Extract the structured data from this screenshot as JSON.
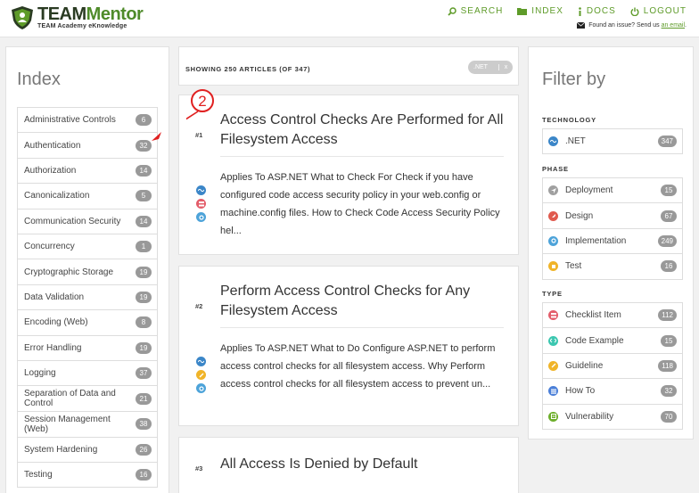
{
  "header": {
    "logo_word1": "TEAM",
    "logo_word2": "Mentor",
    "logo_sub": "TEAM Academy eKnowledge",
    "nav": [
      {
        "icon": "search-icon",
        "label": "SEARCH"
      },
      {
        "icon": "folder-icon",
        "label": "INDEX"
      },
      {
        "icon": "info-icon",
        "label": "DOCS"
      },
      {
        "icon": "power-icon",
        "label": "LOGOUT"
      }
    ],
    "issue_text": "Found an issue? Send us ",
    "issue_link": "an email",
    "issue_end": "."
  },
  "index": {
    "title": "Index",
    "items": [
      {
        "label": "Administrative Controls",
        "count": "6"
      },
      {
        "label": "Authentication",
        "count": "32"
      },
      {
        "label": "Authorization",
        "count": "14"
      },
      {
        "label": "Canonicalization",
        "count": "5"
      },
      {
        "label": "Communication Security",
        "count": "14"
      },
      {
        "label": "Concurrency",
        "count": "1"
      },
      {
        "label": "Cryptographic Storage",
        "count": "19"
      },
      {
        "label": "Data Validation",
        "count": "19"
      },
      {
        "label": "Encoding (Web)",
        "count": "8"
      },
      {
        "label": "Error Handling",
        "count": "19"
      },
      {
        "label": "Logging",
        "count": "37"
      },
      {
        "label": "Separation of Data and Control",
        "count": "21"
      },
      {
        "label": "Session Management (Web)",
        "count": "38"
      },
      {
        "label": "System Hardening",
        "count": "26"
      },
      {
        "label": "Testing",
        "count": "16"
      }
    ]
  },
  "results": {
    "showing": "SHOWING 250 ARTICLES (OF 347)",
    "chip_label": ".NET",
    "chip_close": "x"
  },
  "articles": [
    {
      "num": "#1",
      "title": "Access Control Checks Are Performed for All Filesystem Access",
      "desc": "Applies To ASP.NET What to Check For Check if you have configured code access security policy in your web.config or machine.config files. How to Check Code Access Security Policy hel..."
    },
    {
      "num": "#2",
      "title": "Perform Access Control Checks for Any Filesystem Access",
      "desc": "Applies To ASP.NET What to Do Configure ASP.NET to perform access control checks for all filesystem access. Why Perform access control checks for all filesystem access to prevent un..."
    },
    {
      "num": "#3",
      "title": "All Access Is Denied by Default",
      "desc": ""
    }
  ],
  "filter": {
    "title": "Filter by",
    "technology_head": "TECHNOLOGY",
    "technology": [
      {
        "label": ".NET",
        "count": "347",
        "icon": "dotnet-icon",
        "color": "#3b86c8"
      }
    ],
    "phase_head": "PHASE",
    "phase": [
      {
        "label": "Deployment",
        "count": "15",
        "icon": "deployment-icon",
        "color": "#a0a0a0"
      },
      {
        "label": "Design",
        "count": "67",
        "icon": "design-icon",
        "color": "#e05a4e"
      },
      {
        "label": "Implementation",
        "count": "249",
        "icon": "implementation-icon",
        "color": "#4da3d9"
      },
      {
        "label": "Test",
        "count": "16",
        "icon": "test-icon",
        "color": "#f0b429"
      }
    ],
    "type_head": "TYPE",
    "type": [
      {
        "label": "Checklist Item",
        "count": "112",
        "icon": "checklist-icon",
        "color": "#e35d6a"
      },
      {
        "label": "Code Example",
        "count": "15",
        "icon": "code-icon",
        "color": "#3cc7b0"
      },
      {
        "label": "Guideline",
        "count": "118",
        "icon": "guideline-icon",
        "color": "#f0b429"
      },
      {
        "label": "How To",
        "count": "32",
        "icon": "howto-icon",
        "color": "#4a7fd8"
      },
      {
        "label": "Vulnerability",
        "count": "70",
        "icon": "vulnerability-icon",
        "color": "#6cae2a"
      }
    ]
  },
  "annotation": {
    "number": "2",
    "color": "#e02020"
  }
}
